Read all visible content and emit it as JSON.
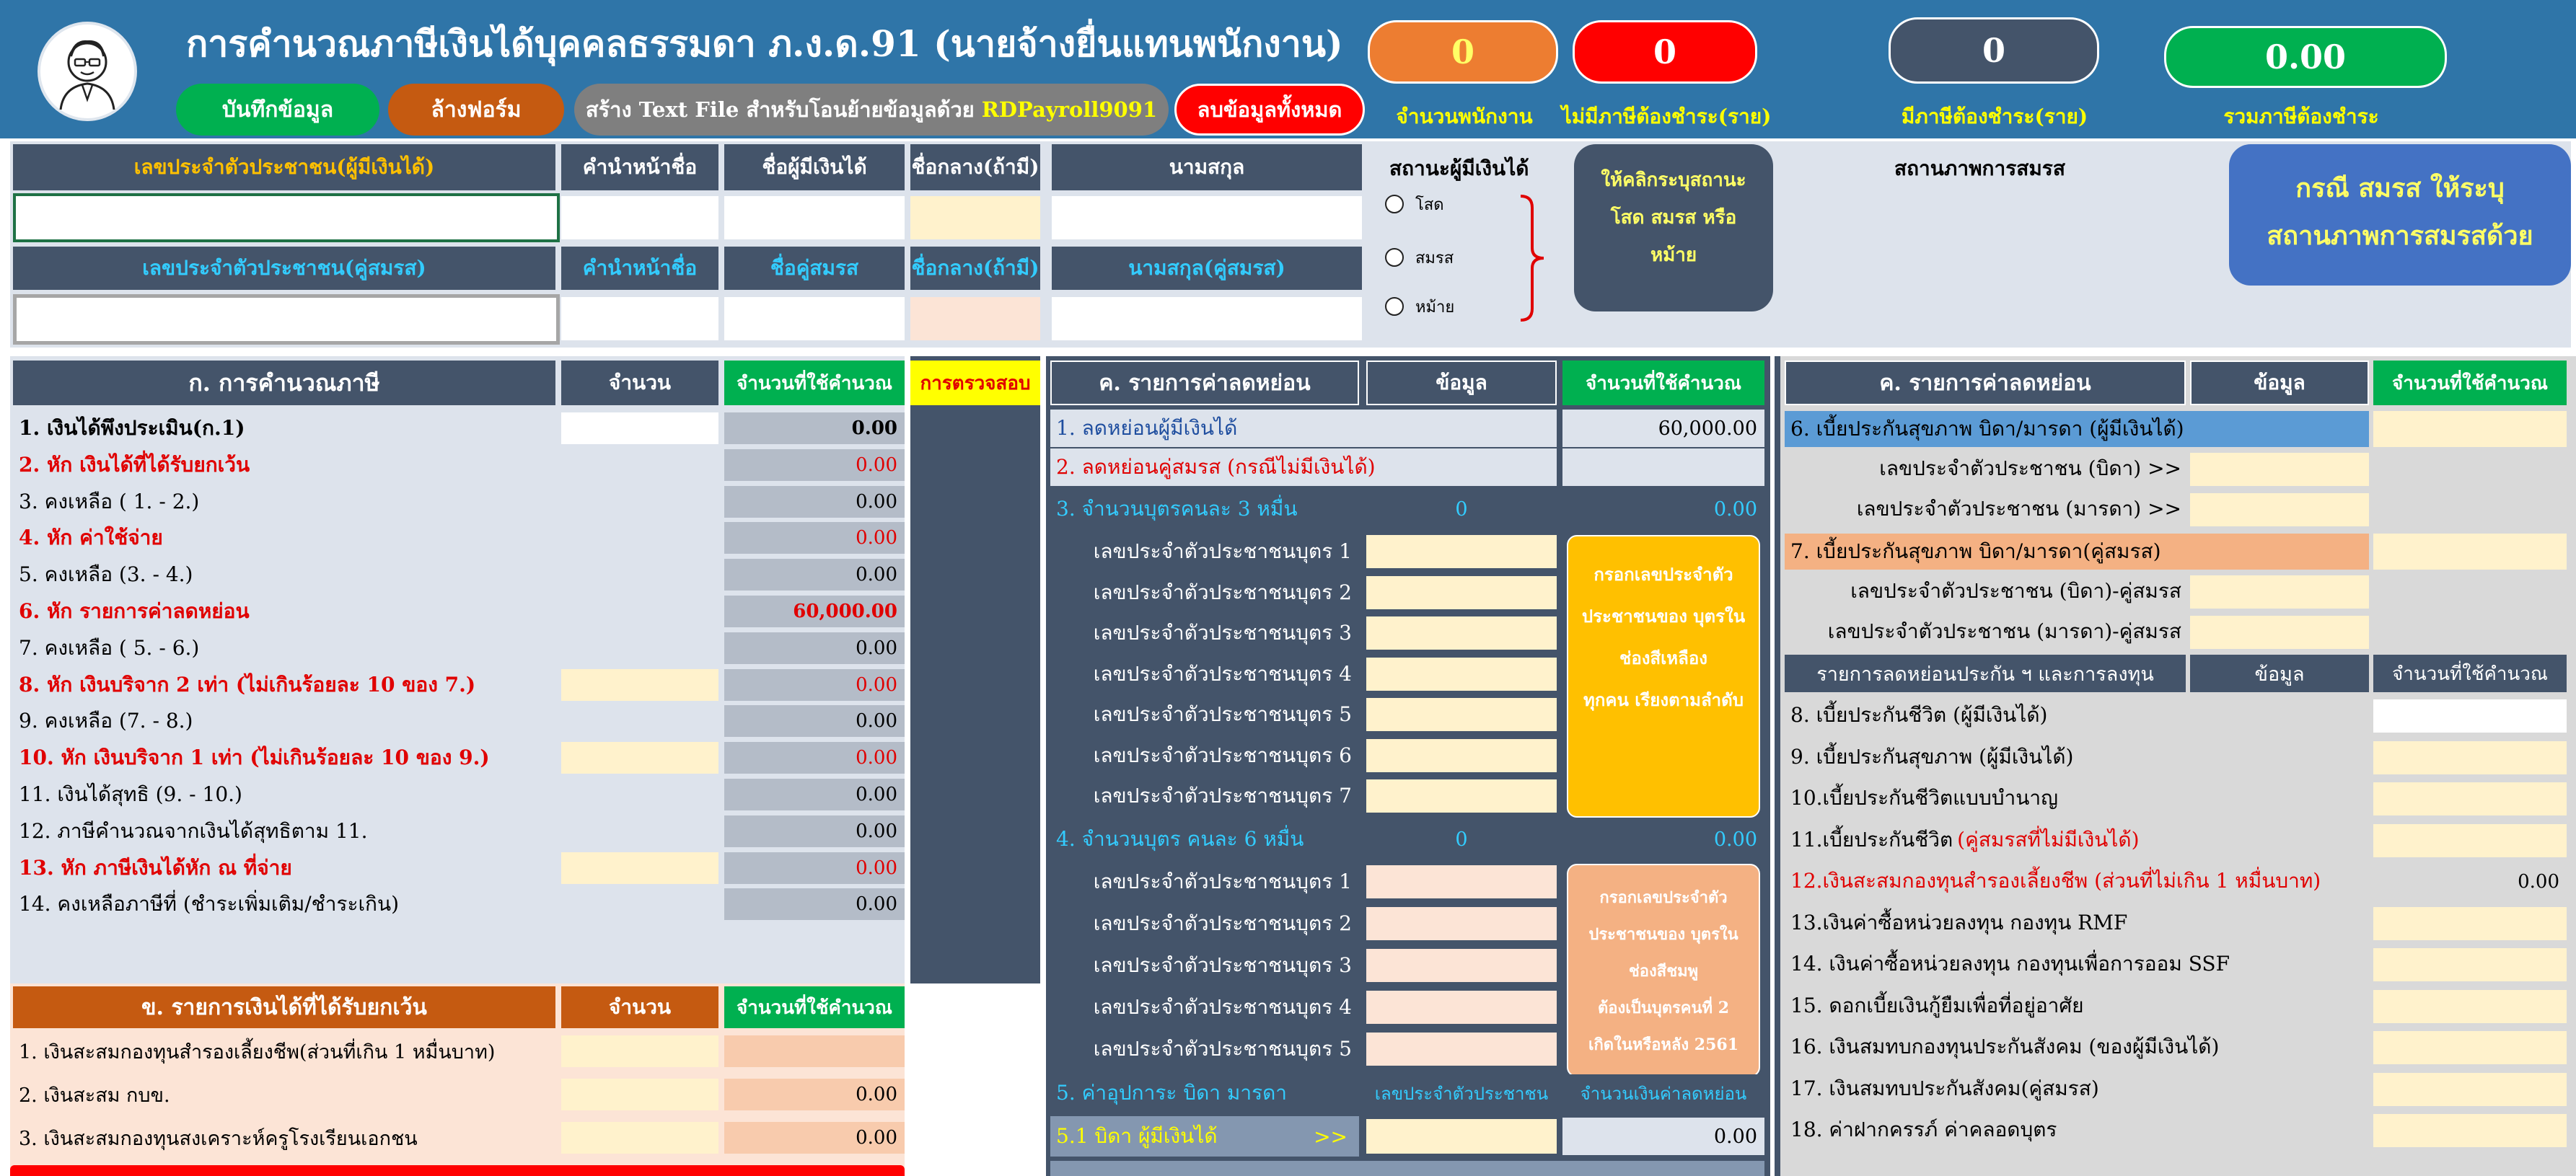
{
  "header": {
    "title": "การคำนวณภาษีเงินได้บุคคลธรรมดา ภ.ง.ด.91 (นายจ้างยื่นแทนพนักงาน)",
    "buttons": {
      "save": "บันทึกข้อมูล",
      "clear_form": "ล้างฟอร์ม",
      "create_text_file": "สร้าง Text File สำหรับโอนย้ายข้อมูลด้วย",
      "create_text_file_highlight": "RDPayroll9091",
      "delete_all": "ลบข้อมูลทั้งหมด"
    },
    "stats": [
      {
        "value": "0",
        "label": "จำนวนพนักงาน",
        "color": "#ed7d31"
      },
      {
        "value": "0",
        "label": "ไม่มีภาษีต้องชำระ(ราย)",
        "color": "#ff0000"
      },
      {
        "value": "0",
        "label": "มีภาษีต้องชำระ(ราย)",
        "color": "#44546a"
      },
      {
        "value": "0.00",
        "label": "รวมภาษีต้องชำระ",
        "color": "#00b050"
      }
    ]
  },
  "personal": {
    "row1_headers": [
      "เลขประจำตัวประชาชน(ผู้มีเงินได้)",
      "คำนำหน้าชื่อ",
      "ชื่อผู้มีเงินได้",
      "ชื่อกลาง(ถ้ามี)",
      "นามสกุล"
    ],
    "row2_headers": [
      "เลขประจำตัวประชาชน(คู่สมรส)",
      "คำนำหน้าชื่อ",
      "ชื่อคู่สมรส",
      "ชื่อกลาง(ถ้ามี)",
      "นามสกุล(คู่สมรส)"
    ],
    "status_title": "สถานะผู้มีเงินได้",
    "status_options": [
      "โสด",
      "สมรส",
      "หม้าย"
    ],
    "status_callout": "ให้คลิกระบุสถานะ โสด สมรส หรือ หม้าย",
    "marital_title": "สถานภาพการสมรส",
    "marital_callout": "กรณี สมรส ให้ระบุ สถานภาพการสมรสด้วย"
  },
  "section_a": {
    "title": "ก. การคำนวณภาษี",
    "col_amount": "จำนวน",
    "col_used": "จำนวนที่ใช้คำนวณ",
    "col_check": "การตรวจสอบ",
    "rows": [
      {
        "label": "1. เงินได้พึงประเมิน(ก.1)",
        "value": "0.00",
        "style": "bold",
        "input": "white"
      },
      {
        "label": "2. หัก เงินได้ที่ได้รับยกเว้น",
        "value": "0.00",
        "style": "red",
        "input": ""
      },
      {
        "label": "3. คงเหลือ ( 1. - 2.)",
        "value": "0.00",
        "style": "",
        "input": ""
      },
      {
        "label": "4. หัก ค่าใช้จ่าย",
        "value": "0.00",
        "style": "red",
        "input": ""
      },
      {
        "label": "5. คงเหลือ (3. - 4.)",
        "value": "0.00",
        "style": "",
        "input": ""
      },
      {
        "label": "6. หัก รายการค่าลดหย่อน",
        "value": "60,000.00",
        "style": "red",
        "input": ""
      },
      {
        "label": "7. คงเหลือ ( 5. - 6.)",
        "value": "0.00",
        "style": "",
        "input": ""
      },
      {
        "label": "8. หัก เงินบริจาก 2 เท่า (ไม่เกินร้อยละ 10 ของ 7.)",
        "value": "0.00",
        "style": "red",
        "input": "cream"
      },
      {
        "label": "9. คงเหลือ (7. - 8.)",
        "value": "0.00",
        "style": "",
        "input": ""
      },
      {
        "label": "10. หัก เงินบริจาก 1 เท่า (ไม่เกินร้อยละ 10 ของ 9.)",
        "value": "0.00",
        "style": "red",
        "input": "cream"
      },
      {
        "label": "11. เงินได้สุทธิ (9. - 10.)",
        "value": "0.00",
        "style": "",
        "input": ""
      },
      {
        "label": "12. ภาษีคำนวณจากเงินได้สุทธิตาม 11.",
        "value": "0.00",
        "style": "",
        "input": ""
      },
      {
        "label": "13. หัก ภาษีเงินได้หัก ณ ที่จ่าย",
        "value": "0.00",
        "style": "red",
        "input": "cream"
      },
      {
        "label": "14. คงเหลือภาษีที่ (ชำระเพิ่มเติม/ชำระเกิน)",
        "value": "0.00",
        "style": "",
        "input": ""
      }
    ]
  },
  "section_b": {
    "title": "ข. รายการเงินได้ที่ได้รับยกเว้น",
    "col_amount": "จำนวน",
    "col_used": "จำนวนที่ใช้คำนวณ",
    "rows": [
      {
        "label": "1. เงินสะสมกองทุนสำรองเลี้ยงชีพ(ส่วนที่เกิน 1 หมื่นบาท)",
        "value": ""
      },
      {
        "label": "2. เงินสะสม กบข.",
        "value": "0.00"
      },
      {
        "label": "3. เงินสะสมกองทุนสงเคราะห์ครูโรงเรียนเอกชน",
        "value": "0.00"
      }
    ]
  },
  "section_c1": {
    "title": "ค. รายการค่าลดหย่อน",
    "col_data": "ข้อมูล",
    "col_used": "จำนวนที่ใช้คำนวณ",
    "row1_label": "1. ลดหย่อนผู้มีเงินได้",
    "row1_value": "60,000.00",
    "row2_label": "2. ลดหย่อนคู่สมรส (กรณีไม่มีเงินได้)",
    "row3_label": "3. จำนวนบุตรคนละ 3 หมื่น",
    "row3_count": "0",
    "row3_value": "0.00",
    "children_a": [
      "เลขประจำตัวประชาชนบุตร 1",
      "เลขประจำตัวประชาชนบุตร 2",
      "เลขประจำตัวประชาชนบุตร 3",
      "เลขประจำตัวประชาชนบุตร 4",
      "เลขประจำตัวประชาชนบุตร 5",
      "เลขประจำตัวประชาชนบุตร 6",
      "เลขประจำตัวประชาชนบุตร 7"
    ],
    "note_a": [
      "กรอกเลขประจำตัว",
      "ประชาชนของ บุตรใน",
      "ช่องสีเหลือง",
      "ทุกคน เรียงตามลำดับ"
    ],
    "row4_label": "4. จำนวนบุตร คนละ 6 หมื่น",
    "row4_count": "0",
    "row4_value": "0.00",
    "children_b": [
      "เลขประจำตัวประชาชนบุตร 1",
      "เลขประจำตัวประชาชนบุตร 2",
      "เลขประจำตัวประชาชนบุตร 3",
      "เลขประจำตัวประชาชนบุตร 4",
      "เลขประจำตัวประชาชนบุตร 5"
    ],
    "note_b": [
      "กรอกเลขประจำตัว",
      "ประชาชนของ บุตรใน",
      "ช่องสีชมพู",
      "ต้องเป็นบุตรคนที่ 2",
      "เกิดในหรือหลัง 2561"
    ],
    "row5_label": "5. ค่าอุปการะ บิดา มารดา",
    "row5_col1": "เลขประจำตัวประชาชน",
    "row5_col2": "จำนวนเงินค่าลดหย่อน",
    "row51_label": "5.1 บิดา ผู้มีเงินได้",
    "row51_arrow": ">>",
    "row51_value": "0.00"
  },
  "section_c2": {
    "title": "ค. รายการค่าลดหย่อน",
    "col_data": "ข้อมูล",
    "col_used": "จำนวนที่ใช้คำนวณ",
    "row6": "6. เบี้ยประกันสุขภาพ บิดา/มารดา (ผู้มีเงินได้)",
    "row6a": "เลขประจำตัวประชาชน (บิดา) >>",
    "row6b": "เลขประจำตัวประชาชน (มารดา) >>",
    "row7": "7. เบี้ยประกันสุขภาพ บิดา/มารดา(คู่สมรส)",
    "row7a": "เลขประจำตัวประชาชน (บิดา)-คู่สมรส",
    "row7b": "เลขประจำตัวประชาชน (มารดา)-คู่สมรส",
    "sub_header": "รายการลดหย่อนประกัน ฯ และการลงทุน",
    "sub_col_data": "ข้อมูล",
    "sub_col_used": "จำนวนที่ใช้คำนวณ",
    "rows": [
      {
        "label": "8. เบี้ยประกันชีวิต (ผู้มีเงินได้)",
        "value": "",
        "style": ""
      },
      {
        "label": "9. เบี้ยประกันสุขภาพ (ผู้มีเงินได้)",
        "value": "",
        "style": ""
      },
      {
        "label": "10.เบี้ยประกันชีวิตแบบบำนาญ",
        "value": "",
        "style": ""
      },
      {
        "label": "11.เบี้ยประกันชีวิต",
        "label_red": "(คู่สมรสที่ไม่มีเงินได้)",
        "value": "",
        "style": "partred"
      },
      {
        "label": "12.เงินสะสมกองทุนสำรองเลี้ยงชีพ (ส่วนที่ไม่เกิน 1 หมื่นบาท)",
        "value": "0.00",
        "style": "red"
      },
      {
        "label": "13.เงินค่าซื้อหน่วยลงทุน กองทุน RMF",
        "value": "",
        "style": ""
      },
      {
        "label": "14. เงินค่าซื้อหน่วยลงทุน กองทุนเพื่อการออม SSF",
        "value": "",
        "style": ""
      },
      {
        "label": "15. ดอกเบี้ยเงินกู้ยืมเพื่อที่อยู่อาศัย",
        "value": "",
        "style": ""
      },
      {
        "label": "16. เงินสมทบกองทุนประกันสังคม (ของผู้มีเงินได้)",
        "value": "",
        "style": ""
      },
      {
        "label": "17. เงินสมทบประกันสังคม(คู่สมรส)",
        "value": "",
        "style": ""
      },
      {
        "label": "18. ค่าฝากครรภ์ ค่าคลอดบุตร",
        "value": "",
        "style": ""
      }
    ]
  }
}
